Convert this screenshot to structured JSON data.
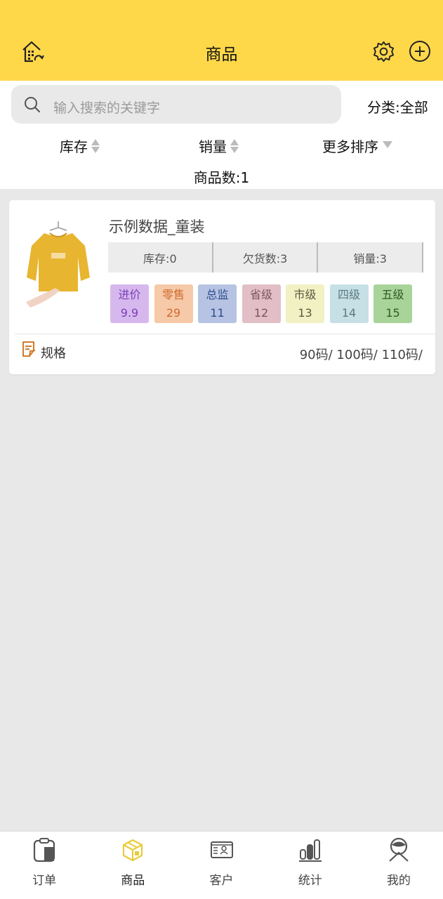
{
  "header": {
    "title": "商品"
  },
  "search": {
    "placeholder": "输入搜索的关键字"
  },
  "category": {
    "label": "分类:全部"
  },
  "sort": {
    "stock": "库存",
    "sales": "销量",
    "more": "更多排序"
  },
  "count_label": "商品数:1",
  "product": {
    "name": "示例数据_童装",
    "stats": [
      "库存:0",
      "欠货数:3",
      "销量:3"
    ],
    "prices": [
      {
        "label": "进价",
        "value": "9.9",
        "bg": "#d6b8ee",
        "fg": "#7a3fb5"
      },
      {
        "label": "零售",
        "value": "29",
        "bg": "#f6c9a8",
        "fg": "#d06a2e"
      },
      {
        "label": "总监",
        "value": "11",
        "bg": "#b7c3e2",
        "fg": "#2d4c8f"
      },
      {
        "label": "省级",
        "value": "12",
        "bg": "#e2bec6",
        "fg": "#7a5560"
      },
      {
        "label": "市级",
        "value": "13",
        "bg": "#f2f1c4",
        "fg": "#5a5a40"
      },
      {
        "label": "四级",
        "value": "14",
        "bg": "#c6e0e6",
        "fg": "#5a7a80"
      },
      {
        "label": "五级",
        "value": "15",
        "bg": "#a8d49a",
        "fg": "#2f5a25"
      }
    ],
    "spec_label": "规格",
    "spec_values": "90码/ 100码/ 110码/"
  },
  "tabs": [
    {
      "label": "订单",
      "icon": "clipboard-icon"
    },
    {
      "label": "商品",
      "icon": "box-icon"
    },
    {
      "label": "客户",
      "icon": "contact-card-icon"
    },
    {
      "label": "统计",
      "icon": "bar-chart-icon"
    },
    {
      "label": "我的",
      "icon": "user-icon"
    }
  ],
  "colors": {
    "accent": "#ffd84a",
    "active_tab": "#e8cc3c"
  }
}
